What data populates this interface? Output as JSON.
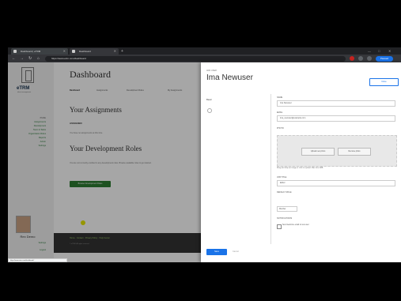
{
  "browser": {
    "tabs": [
      {
        "title": "Dashboard | eTRM"
      },
      {
        "title": "Dashboard"
      }
    ],
    "new_tab": "+",
    "window_controls": [
      "—",
      "□",
      "✕"
    ],
    "url": "https://www.etrm.com/dashboard",
    "profile_label": "Paused"
  },
  "sidebar": {
    "logo": "eTRM",
    "logo_sub": "talent management",
    "items": [
      {
        "label": "Profile"
      },
      {
        "label": "Assignments"
      },
      {
        "label": "Development"
      },
      {
        "label": "Team & Tasks"
      },
      {
        "label": "Organization Roles"
      },
      {
        "label": "Reports"
      },
      {
        "label": "Admin"
      },
      {
        "label": "Settings"
      }
    ],
    "user_name": "Rex Demo",
    "footer_items": [
      "Settings",
      "Logout"
    ]
  },
  "main": {
    "title": "Dashboard",
    "tabs": [
      "Dashboard",
      "Assignments",
      "Development Roles",
      "My Assignments"
    ],
    "assignments_title": "Your Assignments",
    "assignments_sub": "ASSIGNED",
    "assignments_text": "You have no assignments at this time.",
    "dev_title": "Your Development Roles",
    "dev_text": "You are not currently enrolled in any development roles. Browse available roles to get started.",
    "dev_button": "Browse Development Roles",
    "footer_links": "Home · Contact · Privacy Policy · Help Center",
    "footer_copy": "© eTRM. All rights reserved."
  },
  "status_url": "https://www.etrm.com/dashboard#",
  "panel": {
    "kicker": "ADD USER",
    "title": "Ima Newuser",
    "close_label": "Close",
    "section": "Basic",
    "fields": {
      "name_label": "NAME",
      "name_value": "Ima Newuser",
      "email_label": "EMAIL",
      "email_value": "ima_newuser@example.com",
      "photo_label": "PHOTO",
      "photo_upload": "Upload new photo",
      "photo_remove": "Remove photo",
      "photo_hint": "Drag and drop an image or click to upload. Max size 2MB.",
      "title_label": "JOB TITLE",
      "title_value": "Editor",
      "role_label": "DEFAULT ROLE",
      "role_value": "Member",
      "notify_label": "NOTIFICATIONS",
      "notify_text": "Send welcome email to new user"
    },
    "save_label": "Save",
    "cancel_label": "Cancel"
  },
  "colors": {
    "accent": "#1a73e8",
    "brand_green": "#2d7d32",
    "link_green": "#2a7a3a"
  }
}
